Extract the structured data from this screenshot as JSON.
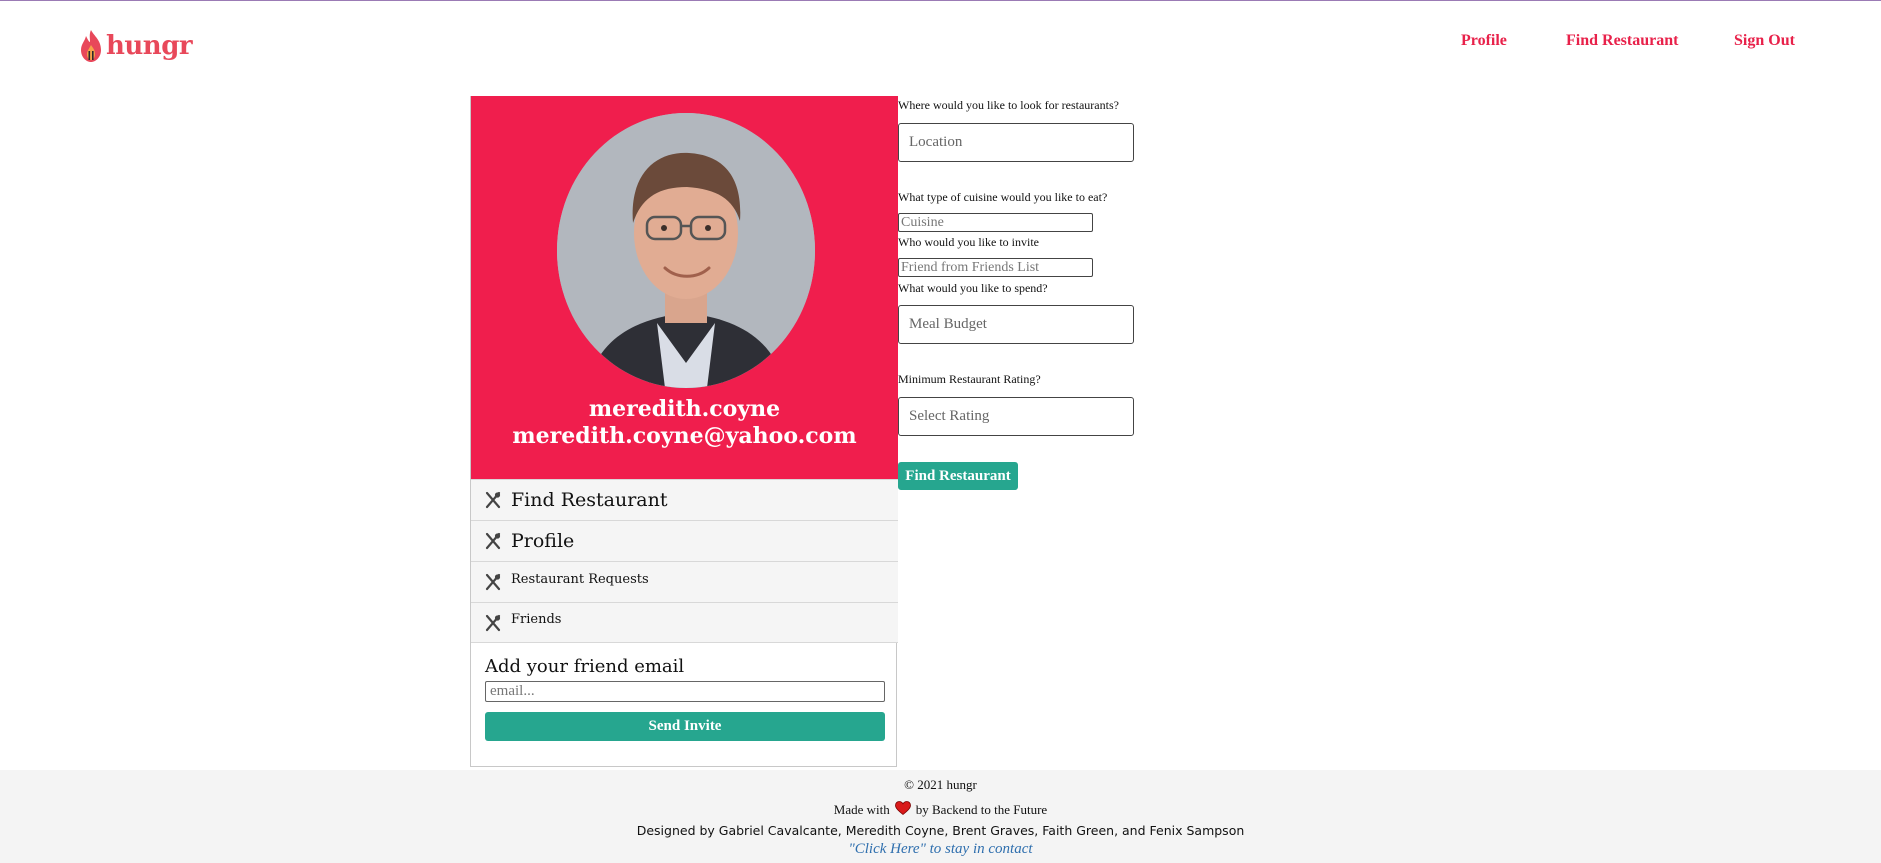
{
  "header": {
    "logo_text": "hungr",
    "nav": {
      "profile": "Profile",
      "find_restaurant": "Find Restaurant",
      "sign_out": "Sign Out"
    }
  },
  "profile_card": {
    "username": "meredith.coyne",
    "email": "meredith.coyne@yahoo.com",
    "menu": [
      {
        "label": "Find Restaurant",
        "icon": "fork-knife-icon"
      },
      {
        "label": "Profile",
        "icon": "fork-knife-icon"
      },
      {
        "label": "Restaurant Requests",
        "icon": "fork-knife-icon"
      },
      {
        "label": "Friends",
        "icon": "fork-knife-icon"
      }
    ],
    "invite": {
      "title": "Add your friend email",
      "placeholder": "email...",
      "button": "Send Invite"
    }
  },
  "search_form": {
    "location": {
      "label": "Where would you like to look for restaurants?",
      "placeholder": "Location"
    },
    "cuisine": {
      "label": "What type of cuisine would you like to eat?",
      "placeholder": "Cuisine"
    },
    "friend": {
      "label": "Who would you like to invite",
      "placeholder": "Friend from Friends List"
    },
    "budget": {
      "label": "What would you like to spend?",
      "placeholder": "Meal Budget"
    },
    "rating": {
      "label": "Minimum Restaurant Rating?",
      "placeholder": "Select Rating"
    },
    "submit": "Find Restaurant"
  },
  "footer": {
    "copyright": "© 2021 hungr",
    "made_with_pre": "Made with",
    "made_with_post": "by Backend to the Future",
    "designed_by": "Designed by Gabriel Cavalcante, Meredith Coyne, Brent Graves, Faith Green, and Fenix Sampson",
    "contact_link": "\"Click Here\" to stay in contact"
  },
  "colors": {
    "brand_red": "#f01e4d",
    "nav_red": "#e8214a",
    "button_green": "#26a68f",
    "link_blue": "#2f6fae"
  }
}
